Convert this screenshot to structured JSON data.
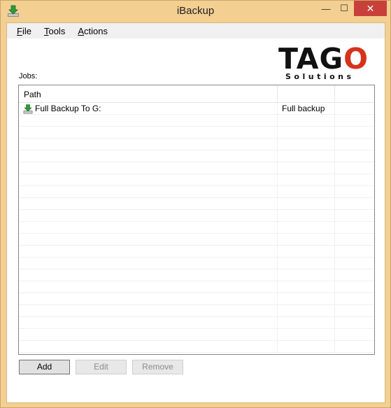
{
  "window": {
    "title": "iBackup",
    "controls": {
      "minimize": "—",
      "maximize": "☐",
      "close": "✕"
    }
  },
  "menu": {
    "items": [
      {
        "accel": "F",
        "rest": "ile"
      },
      {
        "accel": "T",
        "rest": "ools"
      },
      {
        "accel": "A",
        "rest": "ctions"
      }
    ]
  },
  "logo": {
    "main_prefix": "TAG",
    "main_accent": "O",
    "sub": "Solutions",
    "accent_color": "#d6321c"
  },
  "jobs": {
    "label": "Jobs:",
    "columns": [
      "Path",
      "",
      ""
    ],
    "rows": [
      {
        "path": "Full Backup To G:",
        "type": "Full backup",
        "extra": "",
        "icon": "download-icon"
      }
    ],
    "empty_row_count": 20
  },
  "buttons": {
    "add": "Add",
    "edit": "Edit",
    "remove": "Remove"
  }
}
